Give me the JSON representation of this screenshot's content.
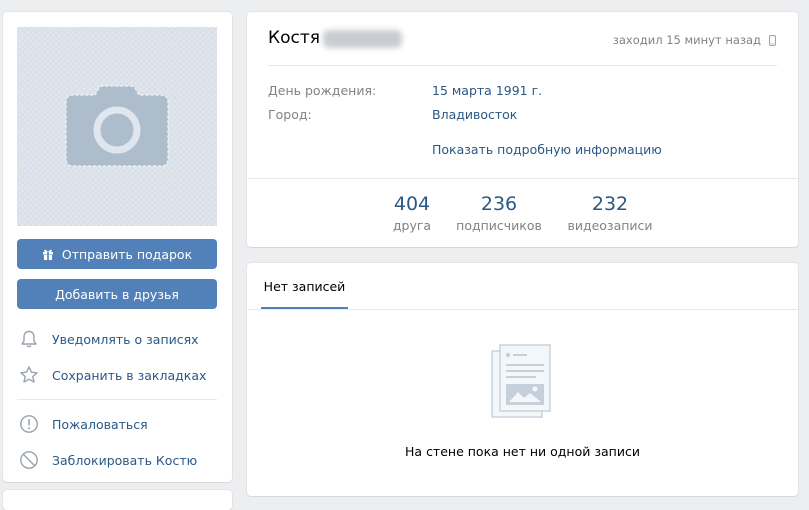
{
  "left": {
    "gift_button": "Отправить подарок",
    "add_friend_button": "Добавить в друзья",
    "actions": [
      {
        "label": "Уведомлять о записях",
        "icon": "bell-icon"
      },
      {
        "label": "Сохранить в закладках",
        "icon": "star-icon"
      },
      {
        "label": "Пожаловаться",
        "icon": "exclamation-circle-icon"
      },
      {
        "label": "Заблокировать Костю",
        "icon": "block-icon"
      }
    ]
  },
  "profile": {
    "first_name": "Костя",
    "last_seen": "заходил 15 минут назад",
    "info": [
      {
        "label": "День рождения:",
        "value": "15 марта 1991 г."
      },
      {
        "label": "Город:",
        "value": "Владивосток"
      }
    ],
    "more_link": "Показать подробную информацию",
    "counters": [
      {
        "num": "404",
        "label": "друга"
      },
      {
        "num": "236",
        "label": "подписчиков"
      },
      {
        "num": "232",
        "label": "видеозаписи"
      }
    ]
  },
  "wall": {
    "tab": "Нет записей",
    "empty_text": "На стене пока нет ни одной записи"
  },
  "colors": {
    "accent": "#5181b8",
    "link": "#2a5885",
    "muted": "#828282",
    "background": "#edeef0"
  }
}
